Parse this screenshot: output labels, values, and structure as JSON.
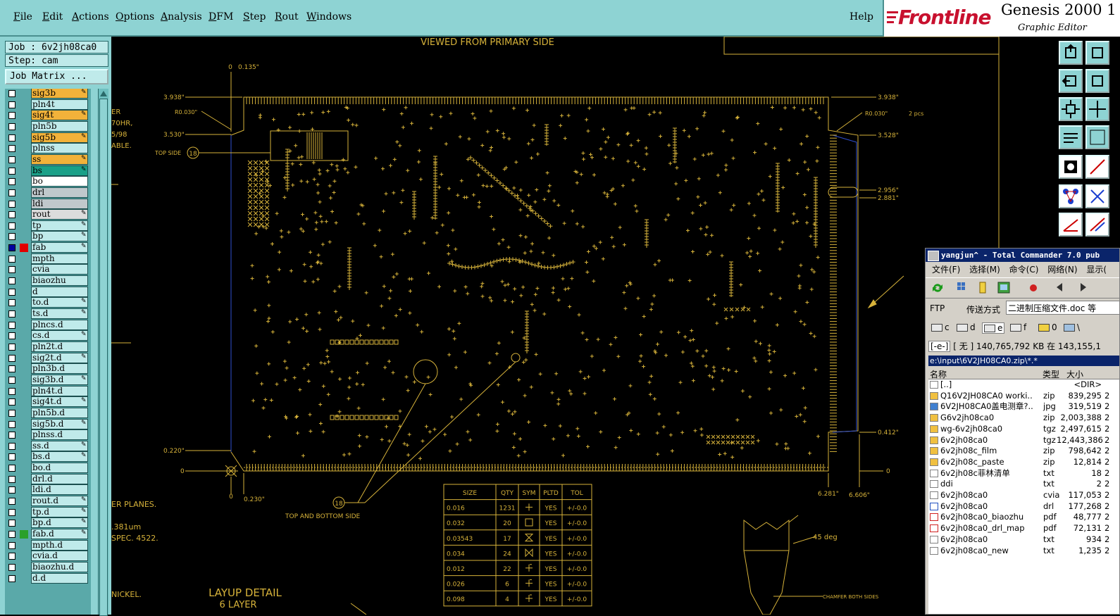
{
  "menubar": {
    "items": [
      "File",
      "Edit",
      "Actions",
      "Options",
      "Analysis",
      "DFM",
      "Step",
      "Rout",
      "Windows"
    ],
    "underline": [
      "F",
      "E",
      "A",
      "O",
      "A",
      "D",
      "S",
      "R",
      "W"
    ],
    "help": "Help"
  },
  "logo": {
    "brand": "Frontline",
    "product": "Genesis 2000 1",
    "subtitle": "Graphic Editor"
  },
  "left_panel": {
    "job": "Job : 6v2jh08ca0",
    "step": "Step: cam",
    "job_matrix": "Job Matrix ...",
    "layers": [
      {
        "name": "sig3b",
        "color": "#f2b23a",
        "edit": true
      },
      {
        "name": "pln4t",
        "color": "#bfeaea",
        "edit": false
      },
      {
        "name": "sig4t",
        "color": "#f2b23a",
        "edit": true
      },
      {
        "name": "pln5b",
        "color": "#bfeaea",
        "edit": false
      },
      {
        "name": "sig5b",
        "color": "#f2b23a",
        "edit": true
      },
      {
        "name": "plnss",
        "color": "#bfeaea",
        "edit": false
      },
      {
        "name": "ss",
        "color": "#f2b23a",
        "edit": true
      },
      {
        "name": "bs",
        "color": "#1aa088",
        "edit": true
      },
      {
        "name": "bo",
        "color": "#ffffff",
        "edit": false
      },
      {
        "name": "drl",
        "color": "#c0c8cc",
        "edit": false
      },
      {
        "name": "ldi",
        "color": "#c0c8cc",
        "edit": false
      },
      {
        "name": "rout",
        "color": "#dcdcdc",
        "edit": true
      },
      {
        "name": "tp",
        "color": "#bfeaea",
        "edit": true
      },
      {
        "name": "bp",
        "color": "#bfeaea",
        "edit": true
      },
      {
        "name": "fab",
        "color": "#bfeaea",
        "edit": true,
        "active": true
      },
      {
        "name": "mpth",
        "color": "#bfeaea",
        "edit": false
      },
      {
        "name": "cvia",
        "color": "#bfeaea",
        "edit": false
      },
      {
        "name": "biaozhu",
        "color": "#bfeaea",
        "edit": false
      },
      {
        "name": "d",
        "color": "#bfeaea",
        "edit": false
      },
      {
        "name": "to.d",
        "color": "#bfeaea",
        "edit": true
      },
      {
        "name": "ts.d",
        "color": "#bfeaea",
        "edit": true
      },
      {
        "name": "plncs.d",
        "color": "#bfeaea",
        "edit": false
      },
      {
        "name": "cs.d",
        "color": "#bfeaea",
        "edit": true
      },
      {
        "name": "pln2t.d",
        "color": "#bfeaea",
        "edit": false
      },
      {
        "name": "sig2t.d",
        "color": "#bfeaea",
        "edit": true
      },
      {
        "name": "pln3b.d",
        "color": "#bfeaea",
        "edit": false
      },
      {
        "name": "sig3b.d",
        "color": "#bfeaea",
        "edit": true
      },
      {
        "name": "pln4t.d",
        "color": "#bfeaea",
        "edit": false
      },
      {
        "name": "sig4t.d",
        "color": "#bfeaea",
        "edit": true
      },
      {
        "name": "pln5b.d",
        "color": "#bfeaea",
        "edit": false
      },
      {
        "name": "sig5b.d",
        "color": "#bfeaea",
        "edit": true
      },
      {
        "name": "plnss.d",
        "color": "#bfeaea",
        "edit": false
      },
      {
        "name": "ss.d",
        "color": "#bfeaea",
        "edit": true
      },
      {
        "name": "bs.d",
        "color": "#bfeaea",
        "edit": true
      },
      {
        "name": "bo.d",
        "color": "#bfeaea",
        "edit": false
      },
      {
        "name": "drl.d",
        "color": "#bfeaea",
        "edit": false
      },
      {
        "name": "ldi.d",
        "color": "#bfeaea",
        "edit": false
      },
      {
        "name": "rout.d",
        "color": "#bfeaea",
        "edit": true
      },
      {
        "name": "tp.d",
        "color": "#bfeaea",
        "edit": true
      },
      {
        "name": "bp.d",
        "color": "#bfeaea",
        "edit": true
      },
      {
        "name": "fab.d",
        "color": "#bfeaea",
        "edit": true,
        "green": true
      },
      {
        "name": "mpth.d",
        "color": "#bfeaea",
        "edit": false
      },
      {
        "name": "cvia.d",
        "color": "#bfeaea",
        "edit": false
      },
      {
        "name": "biaozhu.d",
        "color": "#bfeaea",
        "edit": false
      },
      {
        "name": "d.d",
        "color": "#bfeaea",
        "edit": false
      }
    ]
  },
  "drawing": {
    "header_text": "VIEWED FROM PRIMARY SIDE",
    "left_notes": [
      "ER",
      "70HR,",
      "5/98",
      "ABLE."
    ],
    "top_side_label": "TOP SIDE",
    "top_side_num": "18",
    "bottom_label": "TOP AND BOTTOM SIDE",
    "bottom_num": "18",
    "dims_left": [
      "3.938\"",
      "R0.030\"",
      "3.530\"",
      "0.220\"",
      "0"
    ],
    "dims_top": [
      "0",
      "0.135\""
    ],
    "dims_right": [
      "3.938\"",
      "R0.030\"",
      "2 pcs",
      "3.528\"",
      "2.956\"",
      "2.881\"",
      "0.412\"",
      "0"
    ],
    "dims_bottom": [
      "0",
      "0.230\"",
      "6.281\"",
      "6.606\""
    ],
    "lower_left_notes": [
      "ER PLANES.",
      ".381um",
      "SPEC. 4522.",
      "NICKEL."
    ],
    "layup_title": "LAYUP DETAIL",
    "layup_sub": "6 LAYER",
    "deg_label": "45 deg",
    "chamfer_label": "CHAMFER BOTH SIDES",
    "drill_table": {
      "headers": [
        "SIZE",
        "QTY",
        "SYM",
        "PLTD",
        "TOL"
      ],
      "rows": [
        [
          "0.016",
          "1231",
          "",
          "YES",
          "+/-0.0"
        ],
        [
          "0.032",
          "20",
          "",
          "YES",
          "+/-0.0"
        ],
        [
          "0.03543",
          "17",
          "",
          "YES",
          "+/-0.0"
        ],
        [
          "0.034",
          "24",
          "",
          "YES",
          "+/-0.0"
        ],
        [
          "0.012",
          "22",
          "",
          "YES",
          "+/-0.0"
        ],
        [
          "0.026",
          "6",
          "",
          "YES",
          "+/-0.0"
        ],
        [
          "0.098",
          "4",
          "",
          "YES",
          "+/-0.0"
        ]
      ]
    }
  },
  "total_commander": {
    "title": "yangjun^ - Total Commander 7.0 pub",
    "menus": [
      "文件(F)",
      "选择(M)",
      "命令(C)",
      "网络(N)",
      "显示("
    ],
    "ftp_label": "FTP",
    "transfer_label": "传送方式",
    "transfer_value": "二进制压缩文件.doc 等",
    "drives": [
      "c",
      "d",
      "e",
      "f",
      "0",
      "\\"
    ],
    "drive_selected": "[-e-]",
    "space_text": "[ 无 ] 140,765,792 KB 在 143,155,1",
    "path": "e:\\input\\6V2JH08CA0.zip\\*.*",
    "columns": [
      "名称",
      "类型",
      "大小"
    ],
    "files": [
      {
        "name": "[..]",
        "ext": "",
        "size": "<DIR>",
        "d": "",
        "icon": "up"
      },
      {
        "name": "Q16V2JH08CA0 worki..",
        "ext": "zip",
        "size": "839,295",
        "d": "2",
        "icon": "zip"
      },
      {
        "name": "6V2JH08CA0盖电测章?..",
        "ext": "jpg",
        "size": "319,519",
        "d": "2",
        "icon": "img"
      },
      {
        "name": "G6v2jh08ca0",
        "ext": "zip",
        "size": "2,003,388",
        "d": "2",
        "icon": "zip"
      },
      {
        "name": "wg-6v2jh08ca0",
        "ext": "tgz",
        "size": "2,497,615",
        "d": "2",
        "icon": "zip"
      },
      {
        "name": "6v2jh08ca0",
        "ext": "tgz",
        "size": "12,443,386",
        "d": "2",
        "icon": "zip"
      },
      {
        "name": "6v2jh08c_film",
        "ext": "zip",
        "size": "798,642",
        "d": "2",
        "icon": "zip"
      },
      {
        "name": "6v2jh08c_paste",
        "ext": "zip",
        "size": "12,814",
        "d": "2",
        "icon": "zip"
      },
      {
        "name": "6v2jh08c菲林清单",
        "ext": "txt",
        "size": "18",
        "d": "2",
        "icon": "txt"
      },
      {
        "name": "ddi",
        "ext": "txt",
        "size": "2",
        "d": "2",
        "icon": "txt"
      },
      {
        "name": "6v2jh08ca0",
        "ext": "cvia",
        "size": "117,053",
        "d": "2",
        "icon": "txt"
      },
      {
        "name": "6v2jh08ca0",
        "ext": "drl",
        "size": "177,268",
        "d": "2",
        "icon": "blue"
      },
      {
        "name": "6v2jh08ca0_biaozhu",
        "ext": "pdf",
        "size": "48,777",
        "d": "2",
        "icon": "pdf"
      },
      {
        "name": "6v2jh08ca0_drl_map",
        "ext": "pdf",
        "size": "72,131",
        "d": "2",
        "icon": "pdf"
      },
      {
        "name": "6v2jh08ca0",
        "ext": "txt",
        "size": "934",
        "d": "2",
        "icon": "txt"
      },
      {
        "name": "6v2jh08ca0_new",
        "ext": "txt",
        "size": "1,235",
        "d": "2",
        "icon": "txt"
      }
    ]
  }
}
